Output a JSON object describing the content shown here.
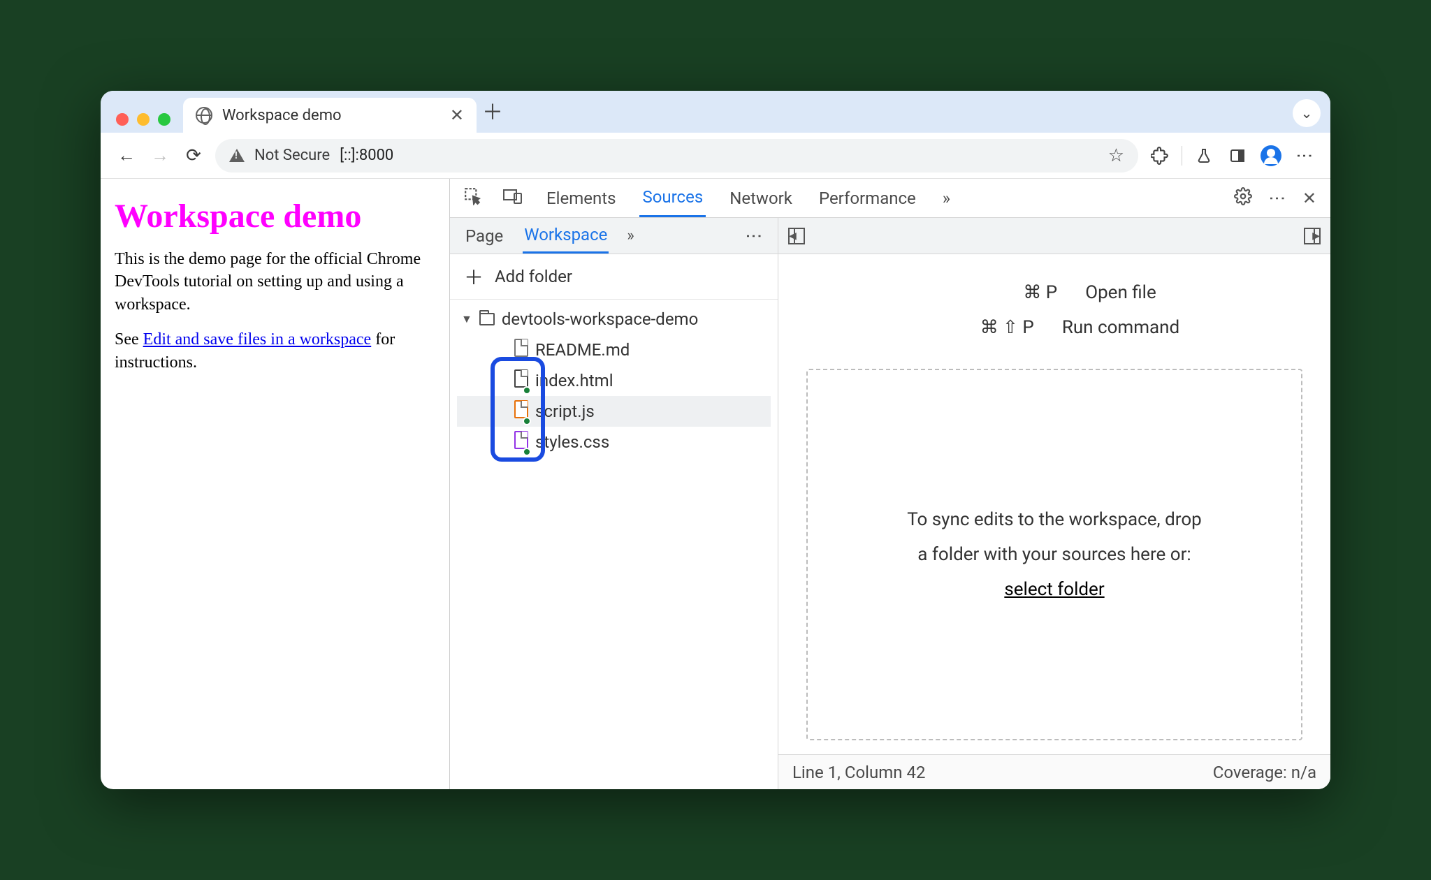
{
  "browser": {
    "tab_title": "Workspace demo",
    "not_secure": "Not Secure",
    "url": "[::]:8000"
  },
  "page": {
    "h1": "Workspace demo",
    "p1": "This is the demo page for the official Chrome DevTools tutorial on setting up and using a workspace.",
    "p2_pre": "See ",
    "link": "Edit and save files in a workspace",
    "p2_post": " for instructions."
  },
  "devtools": {
    "tabs": {
      "elements": "Elements",
      "sources": "Sources",
      "network": "Network",
      "performance": "Performance"
    },
    "subtabs": {
      "page": "Page",
      "workspace": "Workspace"
    },
    "add_folder": "Add folder",
    "folder": "devtools-workspace-demo",
    "files": {
      "readme": "README.md",
      "index": "index.html",
      "script": "script.js",
      "styles": "styles.css"
    },
    "shortcut1_keys": "⌘ P",
    "shortcut1_label": "Open file",
    "shortcut2_keys": "⌘ ⇧ P",
    "shortcut2_label": "Run command",
    "dropzone_line1": "To sync edits to the workspace, drop",
    "dropzone_line2": "a folder with your sources here or:",
    "dropzone_link": "select folder",
    "status_left": "Line 1, Column 42",
    "status_right": "Coverage: n/a"
  }
}
